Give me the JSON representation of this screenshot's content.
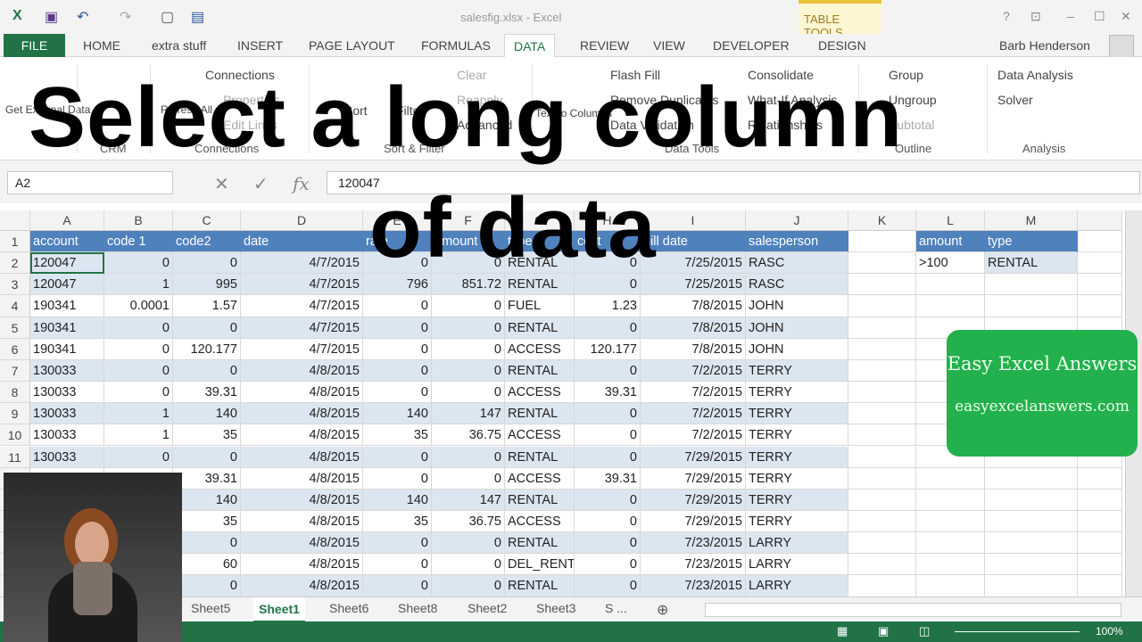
{
  "window": {
    "title": "salesfig.xlsx - Excel",
    "context_tab_group": "TABLE TOOLS",
    "user": "Barb Henderson"
  },
  "tabs": [
    "FILE",
    "HOME",
    "extra stuff",
    "INSERT",
    "PAGE LAYOUT",
    "FORMULAS",
    "DATA",
    "REVIEW",
    "VIEW",
    "DEVELOPER",
    "DESIGN"
  ],
  "active_tab": "DATA",
  "ribbon": {
    "get_external": "Get External Data",
    "crm_group": "CRM",
    "connections": "Connections",
    "properties": "Properties",
    "edit_links": "Edit Links",
    "refresh_all": "Refresh All",
    "connections_group": "Connections",
    "sort": "Sort",
    "filter": "Filter",
    "clear": "Clear",
    "reapply": "Reapply",
    "advanced": "Advanced",
    "sort_filter_group": "Sort & Filter",
    "text_to_columns": "Text to Columns",
    "flash_fill": "Flash Fill",
    "remove_duplicates": "Remove Duplicates",
    "data_validation": "Data Validation",
    "consolidate": "Consolidate",
    "what_if": "What-If Analysis",
    "relationships": "Relationships",
    "data_tools_group": "Data Tools",
    "group": "Group",
    "ungroup": "Ungroup",
    "subtotal": "Subtotal",
    "outline_group": "Outline",
    "data_analysis": "Data Analysis",
    "solver": "Solver",
    "analysis_group": "Analysis"
  },
  "formula_bar": {
    "name_box": "A2",
    "value": "120047"
  },
  "columns": [
    "A",
    "B",
    "C",
    "D",
    "E",
    "F",
    "G",
    "H",
    "I",
    "J",
    "K",
    "L",
    "M"
  ],
  "table": {
    "headers": [
      "account",
      "code 1",
      "code2",
      "date",
      "rate",
      "amount",
      "type",
      "cost",
      "bill date",
      "salesperson"
    ],
    "rows": [
      [
        "120047",
        "0",
        "0",
        "4/7/2015",
        "0",
        "0",
        "RENTAL",
        "0",
        "7/25/2015",
        "RASC"
      ],
      [
        "120047",
        "1",
        "995",
        "4/7/2015",
        "796",
        "851.72",
        "RENTAL",
        "0",
        "7/25/2015",
        "RASC"
      ],
      [
        "190341",
        "0.0001",
        "1.57",
        "4/7/2015",
        "0",
        "0",
        "FUEL",
        "1.23",
        "7/8/2015",
        "JOHN"
      ],
      [
        "190341",
        "0",
        "0",
        "4/7/2015",
        "0",
        "0",
        "RENTAL",
        "0",
        "7/8/2015",
        "JOHN"
      ],
      [
        "190341",
        "0",
        "120.177",
        "4/7/2015",
        "0",
        "0",
        "ACCESS",
        "120.177",
        "7/8/2015",
        "JOHN"
      ],
      [
        "130033",
        "0",
        "0",
        "4/8/2015",
        "0",
        "0",
        "RENTAL",
        "0",
        "7/2/2015",
        "TERRY"
      ],
      [
        "130033",
        "0",
        "39.31",
        "4/8/2015",
        "0",
        "0",
        "ACCESS",
        "39.31",
        "7/2/2015",
        "TERRY"
      ],
      [
        "130033",
        "1",
        "140",
        "4/8/2015",
        "140",
        "147",
        "RENTAL",
        "0",
        "7/2/2015",
        "TERRY"
      ],
      [
        "130033",
        "1",
        "35",
        "4/8/2015",
        "35",
        "36.75",
        "ACCESS",
        "0",
        "7/2/2015",
        "TERRY"
      ],
      [
        "130033",
        "0",
        "0",
        "4/8/2015",
        "0",
        "0",
        "RENTAL",
        "0",
        "7/29/2015",
        "TERRY"
      ],
      [
        "",
        "",
        "39.31",
        "4/8/2015",
        "0",
        "0",
        "ACCESS",
        "39.31",
        "7/29/2015",
        "TERRY"
      ],
      [
        "",
        "",
        "140",
        "4/8/2015",
        "140",
        "147",
        "RENTAL",
        "0",
        "7/29/2015",
        "TERRY"
      ],
      [
        "",
        "",
        "35",
        "4/8/2015",
        "35",
        "36.75",
        "ACCESS",
        "0",
        "7/29/2015",
        "TERRY"
      ],
      [
        "",
        "",
        "0",
        "4/8/2015",
        "0",
        "0",
        "RENTAL",
        "0",
        "7/23/2015",
        "LARRY"
      ],
      [
        "",
        "",
        "60",
        "4/8/2015",
        "0",
        "0",
        "DEL_RENT",
        "0",
        "7/23/2015",
        "LARRY"
      ],
      [
        "",
        "",
        "0",
        "4/8/2015",
        "0",
        "0",
        "RENTAL",
        "0",
        "7/23/2015",
        "LARRY"
      ]
    ]
  },
  "criteria": {
    "headers": [
      "amount",
      "type"
    ],
    "values": [
      ">100",
      "RENTAL"
    ]
  },
  "sheets": [
    "Sheet5",
    "Sheet1",
    "Sheet6",
    "Sheet8",
    "Sheet2",
    "Sheet3",
    "S ..."
  ],
  "active_sheet": "Sheet1",
  "status": {
    "zoom": "100%"
  },
  "overlay": {
    "line1": "Select a long column",
    "line2": "of data"
  },
  "brand": {
    "name": "Easy Excel Answers",
    "url": "easyexcelanswers.com"
  }
}
